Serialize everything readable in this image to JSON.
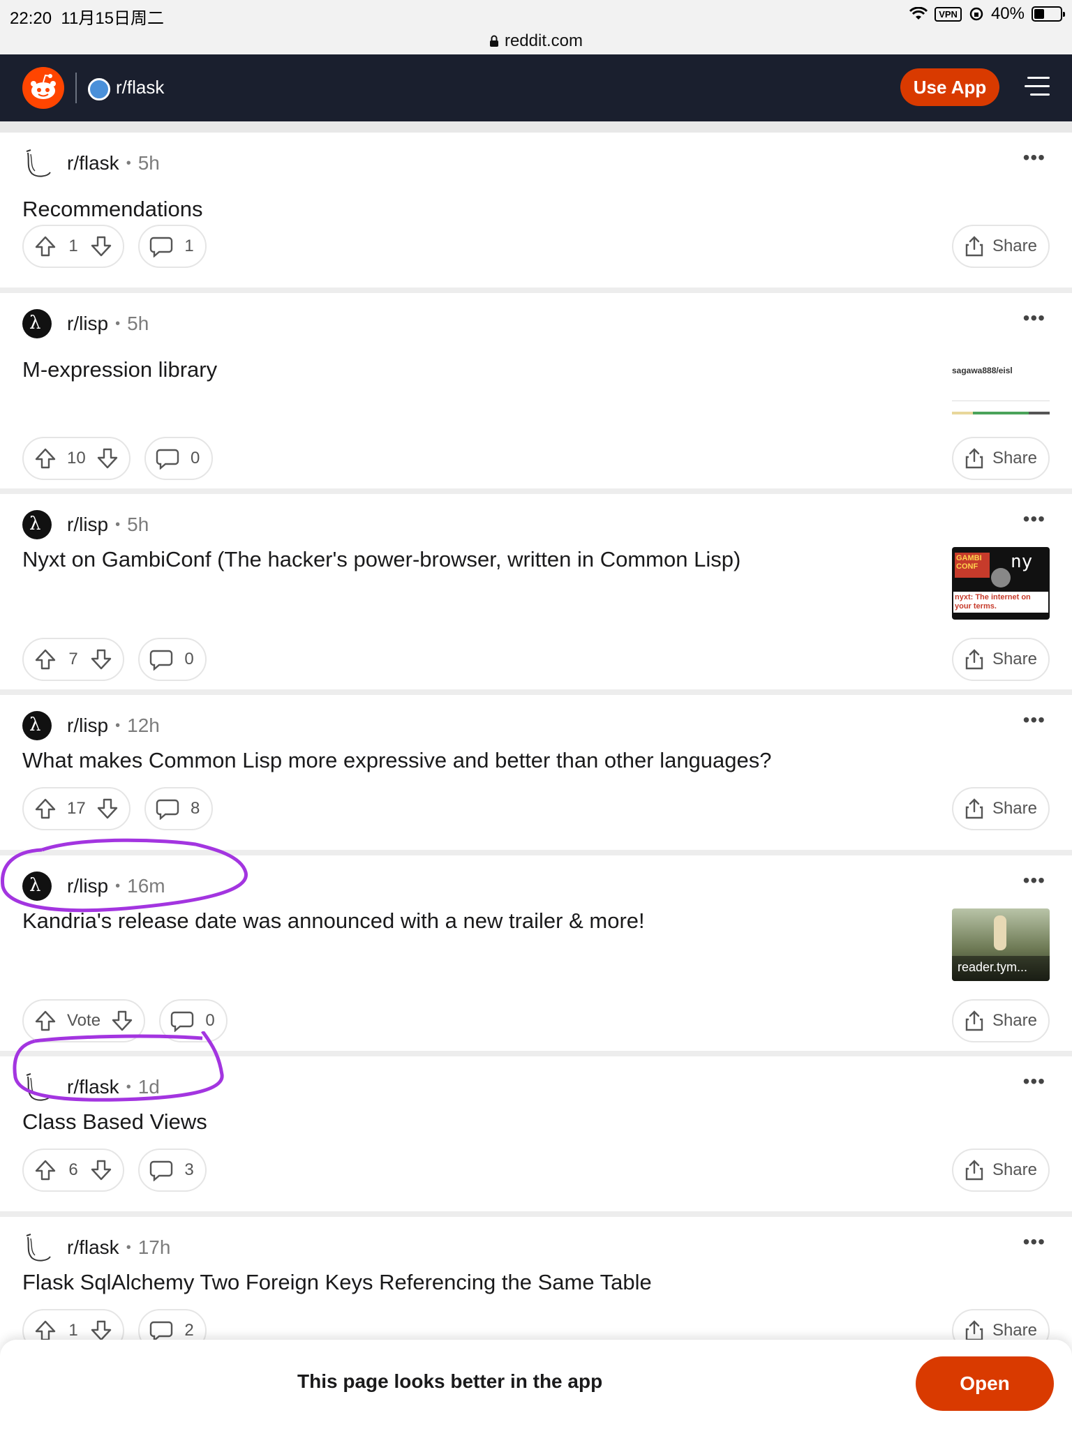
{
  "status_bar": {
    "time": "22:20",
    "date": "11月15日周二",
    "vpn": "VPN",
    "battery": "40%",
    "battery_level": 0.4
  },
  "url_bar": {
    "url": "reddit.com"
  },
  "header": {
    "subreddit": "r/flask",
    "use_app_label": "Use App"
  },
  "posts": [
    {
      "subreddit": "r/flask",
      "time": "5h",
      "title": "Recommendations",
      "votes": "1",
      "comments": "1",
      "share": "Share"
    },
    {
      "subreddit": "r/lisp",
      "time": "5h",
      "title": "M-expression library",
      "votes": "10",
      "comments": "0",
      "share": "Share",
      "thumb_text": "sagawa888/eisl"
    },
    {
      "subreddit": "r/lisp",
      "time": "5h",
      "title": "Nyxt on GambiConf (The hacker's power-browser, written in Common Lisp)",
      "votes": "7",
      "comments": "0",
      "share": "Share",
      "thumb_text": "nyxt: The internet on your terms."
    },
    {
      "subreddit": "r/lisp",
      "time": "12h",
      "title": "What makes Common Lisp more expressive and better than other languages?",
      "votes": "17",
      "comments": "8",
      "share": "Share"
    },
    {
      "subreddit": "r/lisp",
      "time": "16m",
      "title": "Kandria's release date was announced with a new trailer & more!",
      "votes": "Vote",
      "comments": "0",
      "share": "Share",
      "thumb_text": "reader.tym..."
    },
    {
      "subreddit": "r/flask",
      "time": "1d",
      "title": "Class Based Views",
      "votes": "6",
      "comments": "3",
      "share": "Share"
    },
    {
      "subreddit": "r/flask",
      "time": "17h",
      "title": "Flask SqlAlchemy Two Foreign Keys Referencing the Same Table",
      "votes": "1",
      "comments": "2",
      "share": "Share"
    }
  ],
  "banner": {
    "message": "This page looks better in the app",
    "open_label": "Open"
  },
  "colors": {
    "brand_orange": "#d93a00",
    "header_bg": "#1a1f2e",
    "annotation": "#a335e0"
  }
}
